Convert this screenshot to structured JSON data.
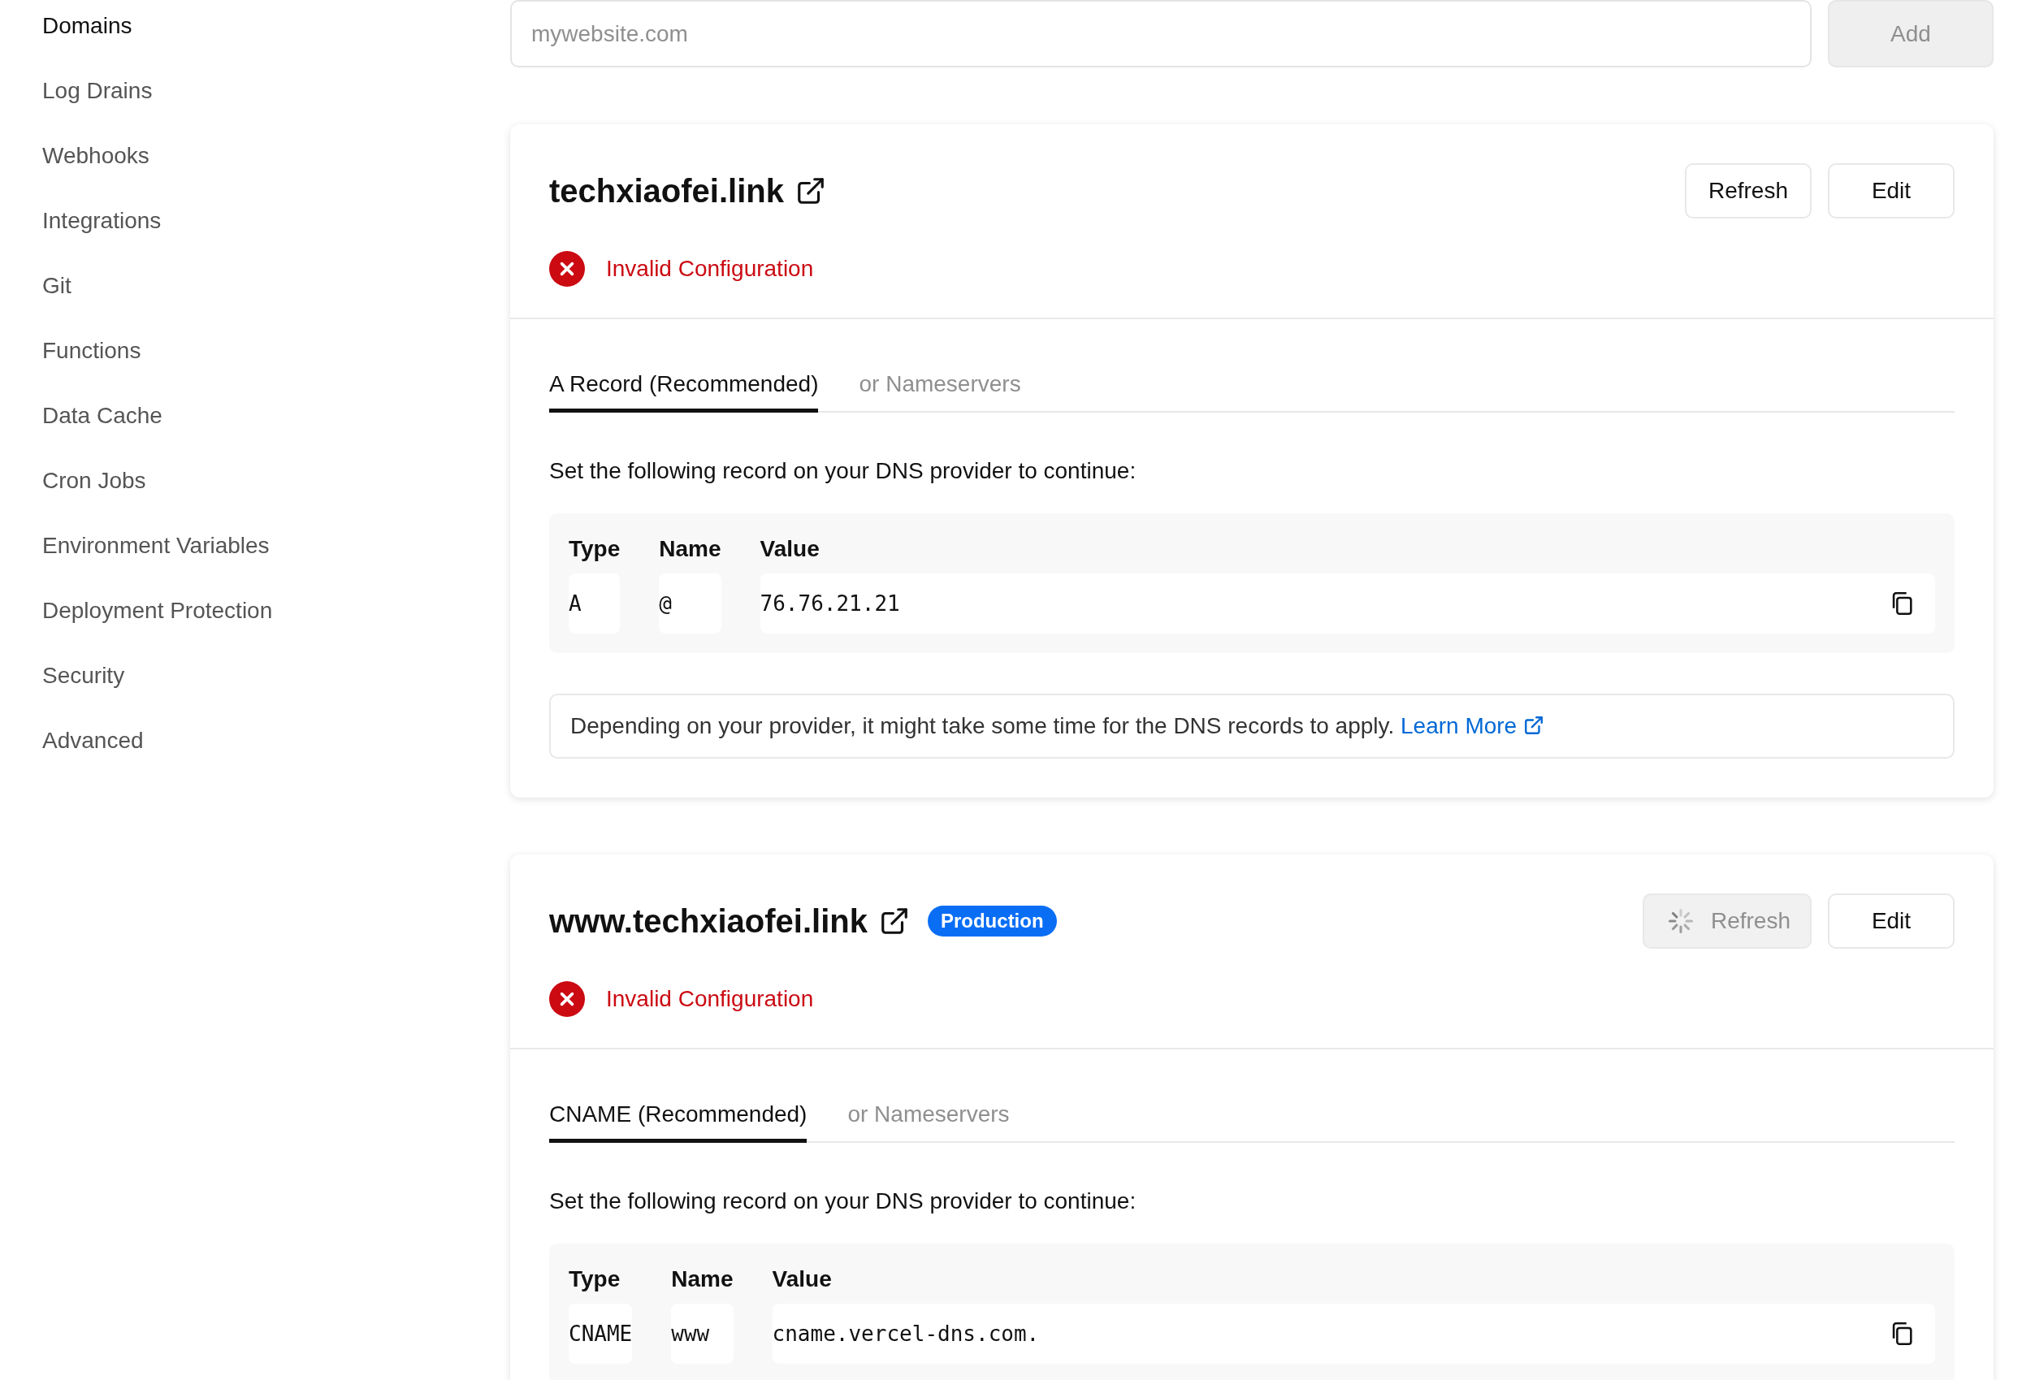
{
  "sidebar": {
    "items": [
      {
        "label": "Domains",
        "selected": true
      },
      {
        "label": "Log Drains",
        "selected": false
      },
      {
        "label": "Webhooks",
        "selected": false
      },
      {
        "label": "Integrations",
        "selected": false
      },
      {
        "label": "Git",
        "selected": false
      },
      {
        "label": "Functions",
        "selected": false
      },
      {
        "label": "Data Cache",
        "selected": false
      },
      {
        "label": "Cron Jobs",
        "selected": false
      },
      {
        "label": "Environment Variables",
        "selected": false
      },
      {
        "label": "Deployment Protection",
        "selected": false
      },
      {
        "label": "Security",
        "selected": false
      },
      {
        "label": "Advanced",
        "selected": false
      }
    ]
  },
  "add_domain": {
    "placeholder": "mywebsite.com",
    "button": "Add"
  },
  "domains": [
    {
      "name": "techxiaofei.link",
      "refresh": {
        "label": "Refresh",
        "loading": false
      },
      "edit": "Edit",
      "status": "Invalid Configuration",
      "tabs": [
        {
          "label": "A Record (Recommended)",
          "selected": true
        },
        {
          "label": "or Nameservers",
          "selected": false
        }
      ],
      "instruction": "Set the following record on your DNS provider to continue:",
      "columns": [
        "Type",
        "Name",
        "Value"
      ],
      "record": [
        "A",
        "@",
        "76.76.21.21"
      ],
      "note": {
        "text": "Depending on your provider, it might take some time for the DNS records to apply.",
        "link": "Learn More"
      }
    },
    {
      "name": "www.techxiaofei.link",
      "badge": "Production",
      "refresh": {
        "label": "Refresh",
        "loading": true
      },
      "edit": "Edit",
      "status": "Invalid Configuration",
      "tabs": [
        {
          "label": "CNAME (Recommended)",
          "selected": true
        },
        {
          "label": "or Nameservers",
          "selected": false
        }
      ],
      "instruction": "Set the following record on your DNS provider to continue:",
      "columns": [
        "Type",
        "Name",
        "Value"
      ],
      "record": [
        "CNAME",
        "www",
        "cname.vercel-dns.com."
      ]
    }
  ]
}
